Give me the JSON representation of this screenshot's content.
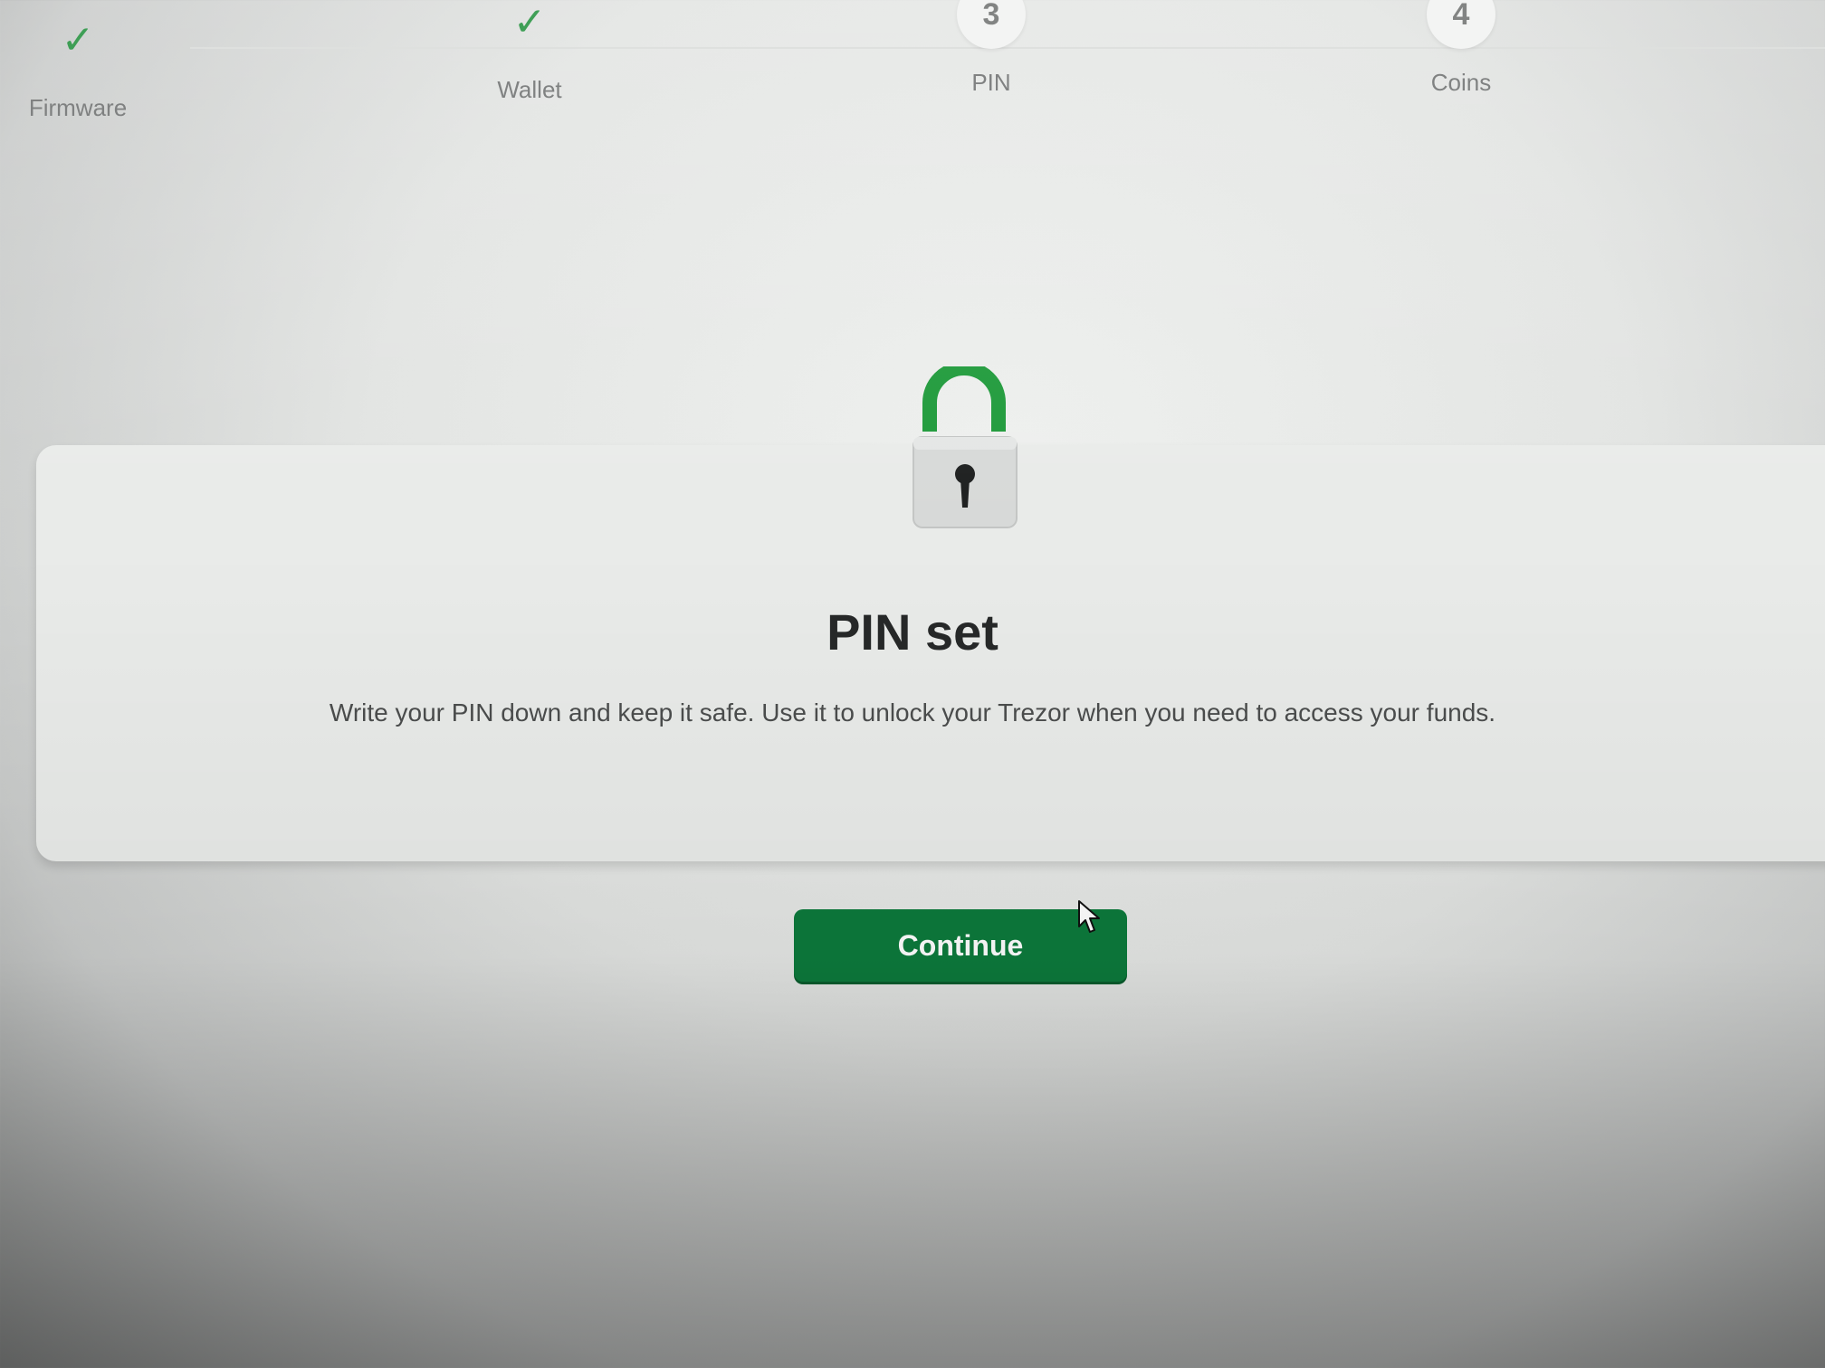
{
  "stepper": {
    "steps": [
      {
        "marker": "✓",
        "label": "Firmware",
        "state": "done"
      },
      {
        "marker": "✓",
        "label": "Wallet",
        "state": "done"
      },
      {
        "marker": "3",
        "label": "PIN",
        "state": "current"
      },
      {
        "marker": "4",
        "label": "Coins",
        "state": "pending"
      }
    ]
  },
  "main": {
    "icon": "unlocked-padlock-icon",
    "title": "PIN set",
    "description": "Write your PIN down and keep it safe. Use it to unlock your Trezor when you need to access your funds.",
    "continue_label": "Continue"
  },
  "colors": {
    "accent": "#0d7a3c",
    "check": "#1f8f3a",
    "text_dark": "#262828",
    "text_muted": "#6e7070"
  }
}
